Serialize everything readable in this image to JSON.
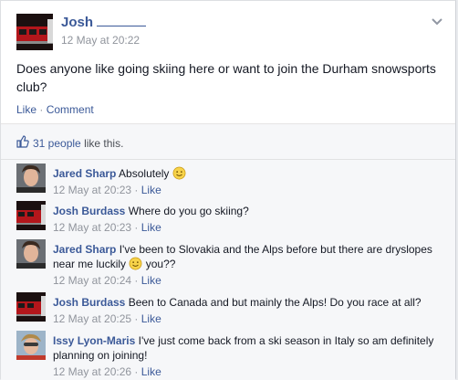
{
  "post": {
    "author": "Josh",
    "timestamp": "12 May at 20:22",
    "text": "Does anyone like going skiing here or want to join the Durham snowsports club?",
    "actions": {
      "like": "Like",
      "separator": "·",
      "comment": "Comment"
    }
  },
  "likes": {
    "count_link": "31 people",
    "suffix": "like this."
  },
  "comments": [
    {
      "name": "Jared Sharp",
      "text": "Absolutely",
      "time": "12 May at 20:23",
      "like": "Like"
    },
    {
      "name": "Josh Burdass",
      "text": "Where do you go skiing?",
      "time": "12 May at 20:23",
      "like": "Like"
    },
    {
      "name": "Jared Sharp",
      "text_before": "I've been to Slovakia and the Alps before but there are dryslopes near me luckily",
      "text_after": "you??",
      "time": "12 May at 20:24",
      "like": "Like"
    },
    {
      "name": "Josh Burdass",
      "text": "Been to Canada and but mainly the Alps! Do you race at all?",
      "time": "12 May at 20:25",
      "like": "Like"
    },
    {
      "name": "Issy Lyon-Maris",
      "text": "I've just come back from a ski season in Italy so am definitely planning on joining!",
      "time": "12 May at 20:26",
      "like": "Like"
    }
  ],
  "colors": {
    "link": "#3b5998",
    "meta": "#90949c",
    "ufi_bg": "#f6f7f9"
  }
}
